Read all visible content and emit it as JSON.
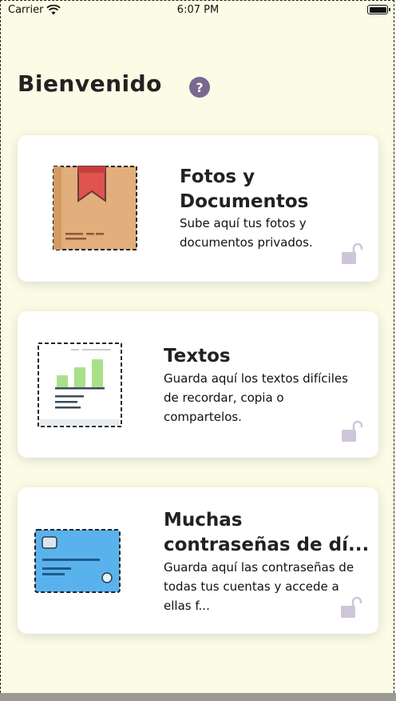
{
  "status_bar": {
    "carrier": "Carrier",
    "time": "6:07 PM"
  },
  "header": {
    "title": "Bienvenido",
    "help_label": "?"
  },
  "cards": [
    {
      "title": "Fotos y Documentos",
      "description": "Sube aquí tus fotos y documentos privados."
    },
    {
      "title": "Textos",
      "description": "Guarda aquí los textos difíciles de recordar, copia o compartelos."
    },
    {
      "title": "Muchas contraseñas de dí...",
      "description": "Guarda aquí las contraseñas de todas tus cuentas y accede a ellas f..."
    }
  ],
  "colors": {
    "background": "#fbfbe6",
    "help_button": "#7a6890",
    "box": "#e1ae7c",
    "bookmark": "#e0534f",
    "chart_green": "#a9e08a",
    "card_blue": "#5ab2ec",
    "lock": "#cfc5d8"
  },
  "icons": [
    "wifi-icon",
    "battery-icon",
    "help-icon",
    "box-icon",
    "chart-doc-icon",
    "credit-card-icon",
    "lock-open-icon"
  ]
}
